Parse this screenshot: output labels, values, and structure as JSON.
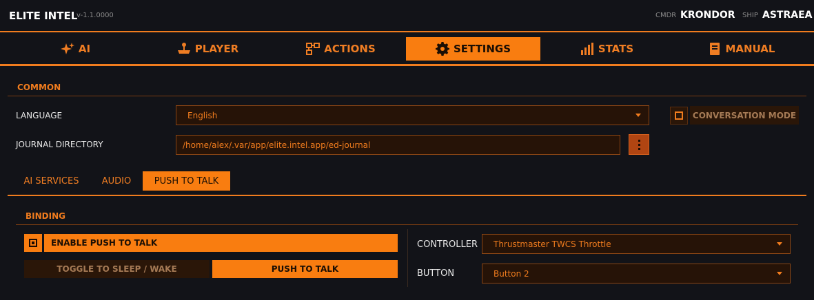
{
  "header": {
    "title": "ELITE INTEL",
    "version": "v-1.1.0000",
    "cmdr_label": "CMDR",
    "cmdr_name": "KRONDOR",
    "ship_label": "SHIP",
    "ship_name": "ASTRAEA"
  },
  "nav": {
    "tabs": [
      {
        "label": "AI",
        "icon": "sparkle-icon"
      },
      {
        "label": "PLAYER",
        "icon": "joystick-icon"
      },
      {
        "label": "ACTIONS",
        "icon": "flowchart-icon"
      },
      {
        "label": "SETTINGS",
        "icon": "gear-icon",
        "active": true
      },
      {
        "label": "STATS",
        "icon": "bar-chart-icon"
      },
      {
        "label": "MANUAL",
        "icon": "book-icon"
      }
    ]
  },
  "common": {
    "title": "COMMON",
    "language_label": "LANGUAGE",
    "language_value": "English",
    "journal_label": "JOURNAL DIRECTORY",
    "journal_value": "/home/alex/.var/app/elite.intel.app/ed-journal",
    "conversation_mode_label": "CONVERSATION MODE",
    "conversation_mode_checked": false
  },
  "sub_tabs": [
    {
      "label": "AI SERVICES"
    },
    {
      "label": "AUDIO"
    },
    {
      "label": "PUSH TO TALK",
      "active": true
    }
  ],
  "binding": {
    "title": "BINDING",
    "enable_label": "ENABLE PUSH TO TALK",
    "enable_checked": true,
    "toggle_label": "TOGGLE TO SLEEP / WAKE",
    "ptt_label": "PUSH TO TALK",
    "controller_label": "CONTROLLER",
    "controller_value": "Thrustmaster TWCS Throttle",
    "button_label": "BUTTON",
    "button_value": "Button 2"
  },
  "colors": {
    "accent": "#f97d10",
    "background": "#121318",
    "field_bg": "#261307"
  }
}
